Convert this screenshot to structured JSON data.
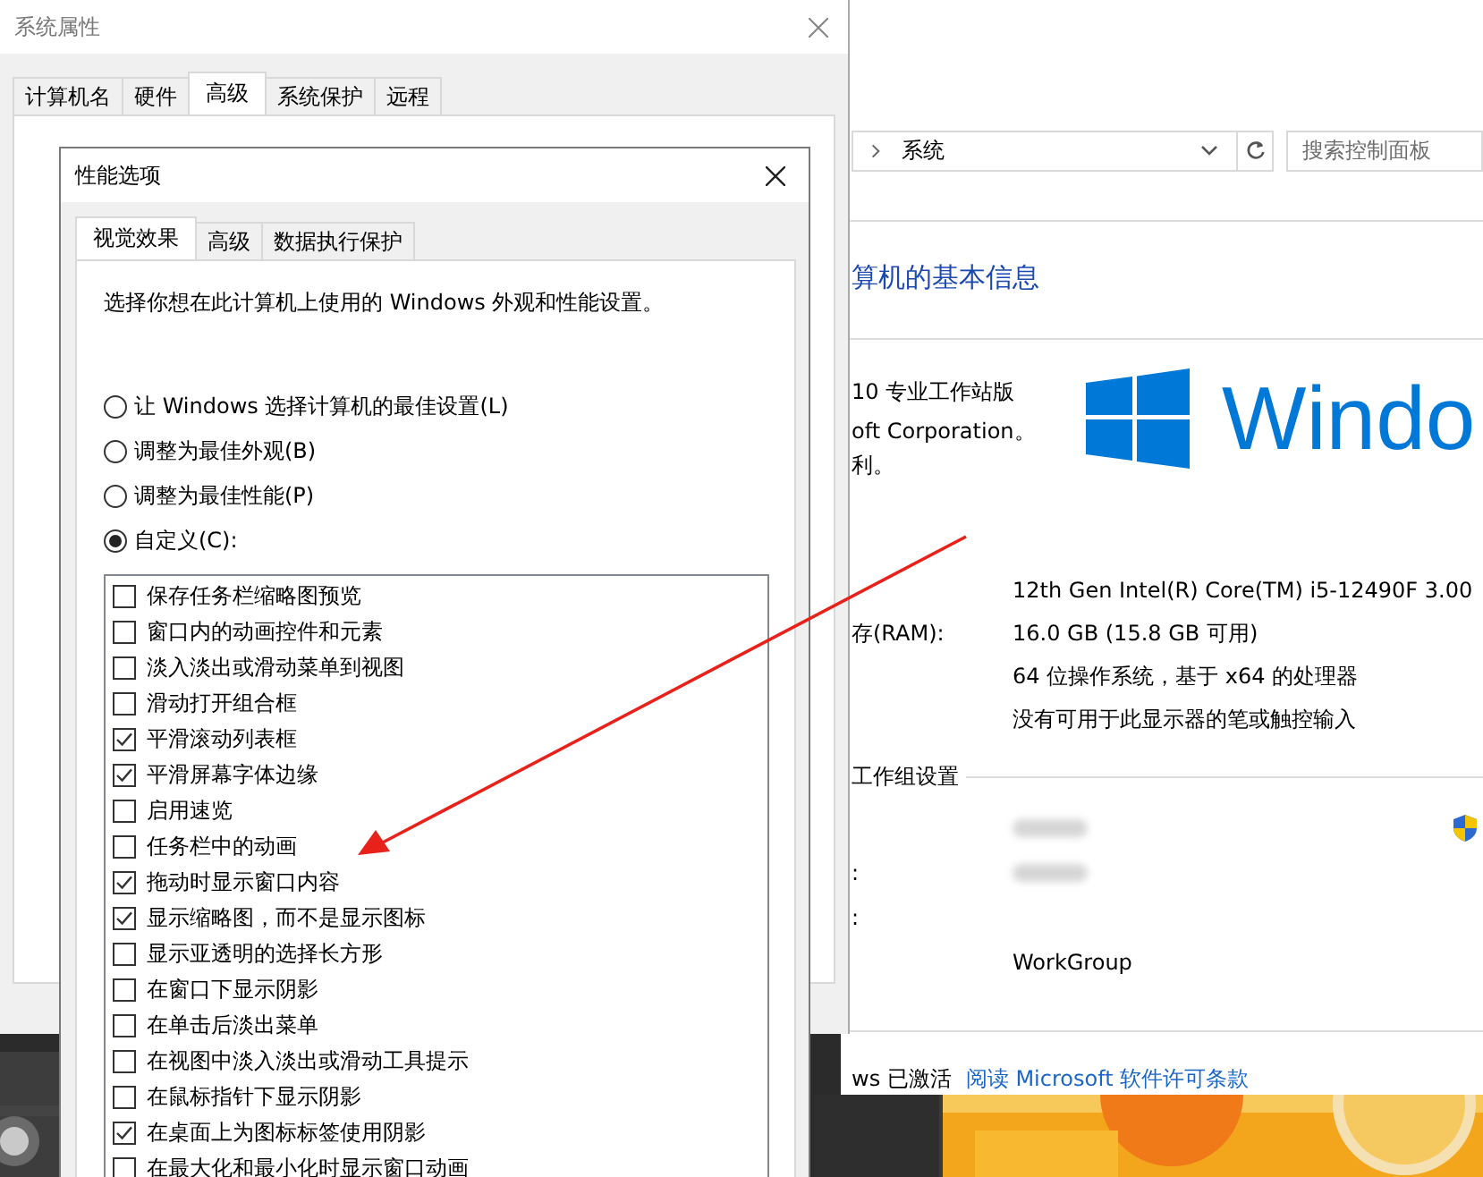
{
  "system_properties": {
    "title": "系统属性",
    "tabs": [
      {
        "label": "计算机名",
        "selected": false
      },
      {
        "label": "硬件",
        "selected": false
      },
      {
        "label": "高级",
        "selected": true
      },
      {
        "label": "系统保护",
        "selected": false
      },
      {
        "label": "远程",
        "selected": false
      }
    ]
  },
  "performance_options": {
    "title": "性能选项",
    "tabs": [
      {
        "label": "视觉效果",
        "selected": true
      },
      {
        "label": "高级",
        "selected": false
      },
      {
        "label": "数据执行保护",
        "selected": false
      }
    ],
    "description": "选择你想在此计算机上使用的 Windows 外观和性能设置。",
    "radios": [
      {
        "label": "让 Windows 选择计算机的最佳设置(L)",
        "selected": false
      },
      {
        "label": "调整为最佳外观(B)",
        "selected": false
      },
      {
        "label": "调整为最佳性能(P)",
        "selected": false
      },
      {
        "label": "自定义(C):",
        "selected": true
      }
    ],
    "effects": [
      {
        "label": "保存任务栏缩略图预览",
        "checked": false
      },
      {
        "label": "窗口内的动画控件和元素",
        "checked": false
      },
      {
        "label": "淡入淡出或滑动菜单到视图",
        "checked": false
      },
      {
        "label": "滑动打开组合框",
        "checked": false
      },
      {
        "label": "平滑滚动列表框",
        "checked": true
      },
      {
        "label": "平滑屏幕字体边缘",
        "checked": true
      },
      {
        "label": "启用速览",
        "checked": false
      },
      {
        "label": "任务栏中的动画",
        "checked": false
      },
      {
        "label": "拖动时显示窗口内容",
        "checked": true
      },
      {
        "label": "显示缩略图，而不是显示图标",
        "checked": true
      },
      {
        "label": "显示亚透明的选择长方形",
        "checked": false
      },
      {
        "label": "在窗口下显示阴影",
        "checked": false
      },
      {
        "label": "在单击后淡出菜单",
        "checked": false
      },
      {
        "label": "在视图中淡入淡出或滑动工具提示",
        "checked": false
      },
      {
        "label": "在鼠标指针下显示阴影",
        "checked": false
      },
      {
        "label": "在桌面上为图标标签使用阴影",
        "checked": true
      },
      {
        "label": "在最大化和最小化时显示窗口动画",
        "checked": false
      }
    ]
  },
  "control_panel": {
    "breadcrumb": "系统",
    "search": {
      "placeholder": "搜索控制面板"
    },
    "heading": "算机的基本信息",
    "edition_lines": [
      "10 专业工作站版",
      "oft Corporation。",
      "利。"
    ],
    "logo_text": "Windo",
    "specs": [
      {
        "value": "12th Gen Intel(R) Core(TM) i5-12490F   3.00"
      },
      {
        "label": "存(RAM):",
        "value": "16.0 GB (15.8 GB 可用)"
      },
      {
        "value": "64 位操作系统，基于 x64 的处理器"
      },
      {
        "value": "没有可用于此显示器的笔或触控输入"
      }
    ],
    "group_heading": "工作组设置",
    "group_rows": [
      {
        "kind": "redacted"
      },
      {
        "label": ":",
        "kind": "redacted"
      },
      {
        "label": ":",
        "kind": "text"
      },
      {
        "kind": "text",
        "value": "WorkGroup"
      }
    ],
    "activation": "ws 已激活",
    "license_link": "阅读 Microsoft 软件许可条款"
  }
}
